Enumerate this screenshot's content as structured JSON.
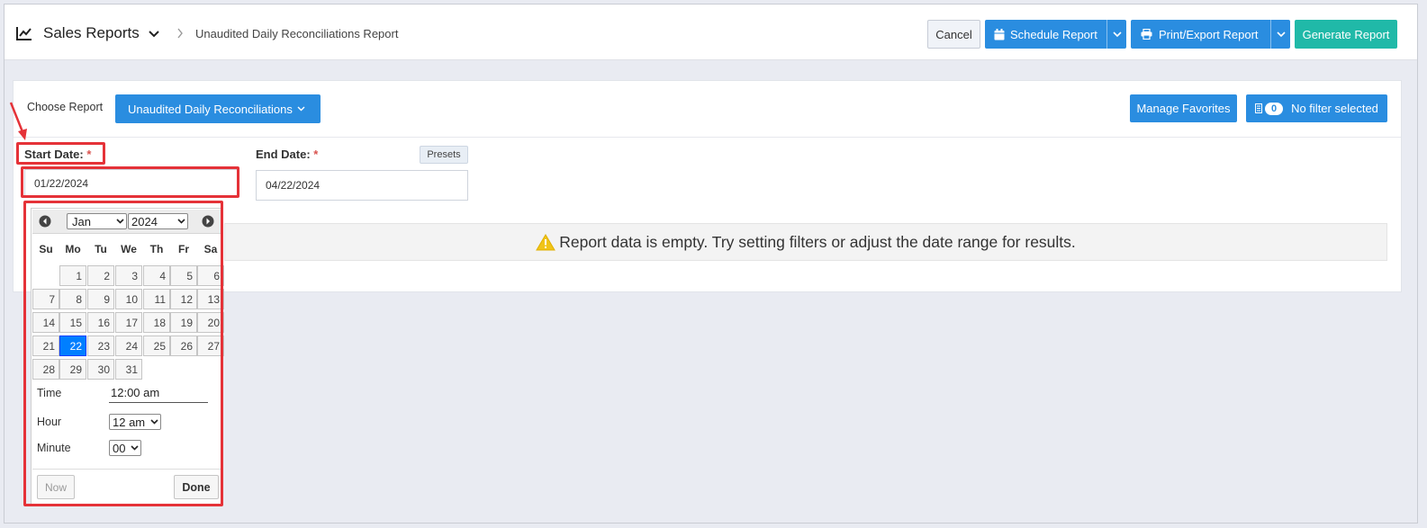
{
  "header": {
    "title": "Sales Reports",
    "breadcrumb": "Unaudited Daily Reconciliations Report",
    "cancel_label": "Cancel",
    "schedule_label": "Schedule Report",
    "export_label": "Print/Export Report",
    "generate_label": "Generate Report"
  },
  "filters": {
    "choose_report_label": "Choose Report",
    "report_selected": "Unaudited Daily Reconciliations",
    "manage_favorites_label": "Manage Favorites",
    "filter_count": "0",
    "filter_status": "No filter selected",
    "start_date_label": "Start Date:",
    "end_date_label": "End Date:",
    "required_mark": "*",
    "presets_label": "Presets",
    "start_date_value": "01/22/2024",
    "end_date_value": "04/22/2024",
    "empty_message": "Report data is empty. Try setting filters or adjust the date range for results."
  },
  "datepicker": {
    "month": "Jan",
    "year": "2024",
    "weekdays": [
      "Su",
      "Mo",
      "Tu",
      "We",
      "Th",
      "Fr",
      "Sa"
    ],
    "days": [
      "1",
      "2",
      "3",
      "4",
      "5",
      "6",
      "7",
      "8",
      "9",
      "10",
      "11",
      "12",
      "13",
      "14",
      "15",
      "16",
      "17",
      "18",
      "19",
      "20",
      "21",
      "22",
      "23",
      "24",
      "25",
      "26",
      "27",
      "28",
      "29",
      "30",
      "31"
    ],
    "selected_day": "22",
    "time_label": "Time",
    "time_value": "12:00 am",
    "hour_label": "Hour",
    "hour_value": "12 am",
    "minute_label": "Minute",
    "minute_value": "00",
    "now_label": "Now",
    "done_label": "Done"
  },
  "colors": {
    "primary": "#2a8de0",
    "success": "#20b9a8",
    "annotation": "#e53238",
    "selected_day": "#007fff"
  }
}
